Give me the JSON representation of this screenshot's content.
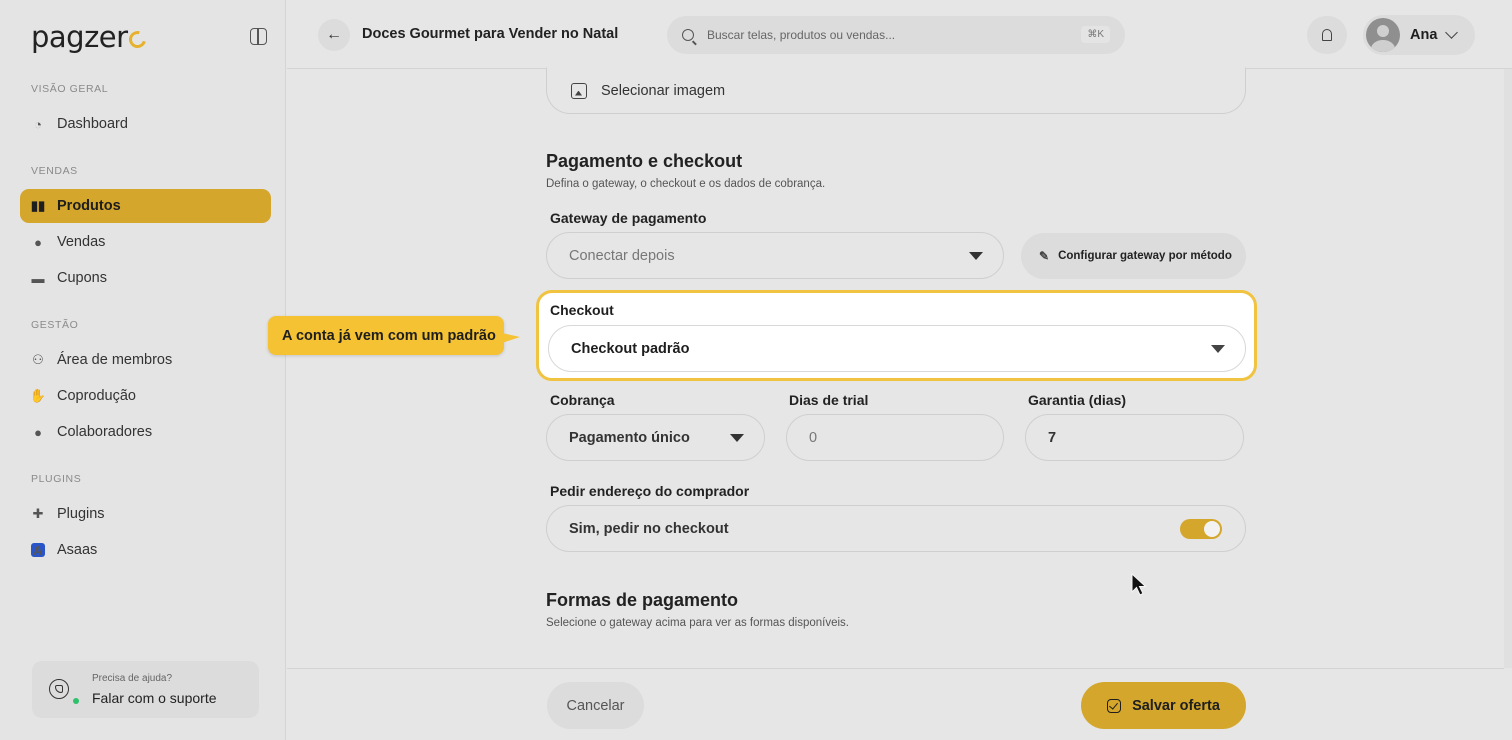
{
  "sidebar": {
    "logo": "pagzer",
    "sections": {
      "overview": "VISÃO GERAL",
      "sales": "VENDAS",
      "management": "GESTÃO",
      "plugins": "PLUGINS"
    },
    "items": {
      "dashboard": "Dashboard",
      "products": "Produtos",
      "sales": "Vendas",
      "coupons": "Cupons",
      "members": "Área de membros",
      "coproduction": "Coprodução",
      "collaborators": "Colaboradores",
      "plugins": "Plugins",
      "asaas": "Asaas"
    },
    "active_item": "products",
    "help": {
      "small": "Precisa de ajuda?",
      "large": "Falar com o suporte"
    }
  },
  "topbar": {
    "title": "Doces Gourmet para Vender no Natal",
    "search_placeholder": "Buscar telas, produtos ou vendas...",
    "search_shortcut": "⌘K",
    "user_name": "Ana"
  },
  "form": {
    "image_button": "Selecionar imagem",
    "payment_section": {
      "title": "Pagamento e checkout",
      "subtitle": "Defina o gateway, o checkout e os dados de cobrança."
    },
    "gateway": {
      "label": "Gateway de pagamento",
      "value": "Conectar depois",
      "configure_button": "Configurar gateway por método"
    },
    "checkout": {
      "label": "Checkout",
      "value": "Checkout padrão"
    },
    "billing": {
      "label": "Cobrança",
      "value": "Pagamento único"
    },
    "trial": {
      "label": "Dias de trial",
      "value": "0"
    },
    "warranty": {
      "label": "Garantia (dias)",
      "value": "7"
    },
    "address": {
      "label": "Pedir endereço do comprador",
      "value": "Sim, pedir no checkout",
      "toggle_on": true
    },
    "methods_section": {
      "title": "Formas de pagamento",
      "subtitle": "Selecione o gateway acima para ver as formas disponíveis."
    }
  },
  "callout": {
    "text": "A conta já vem com um padrão"
  },
  "footer": {
    "cancel": "Cancelar",
    "save": "Salvar oferta"
  },
  "colors": {
    "accent": "#d4a62b",
    "callout": "#f5c233",
    "highlight_border": "#f0c340"
  }
}
